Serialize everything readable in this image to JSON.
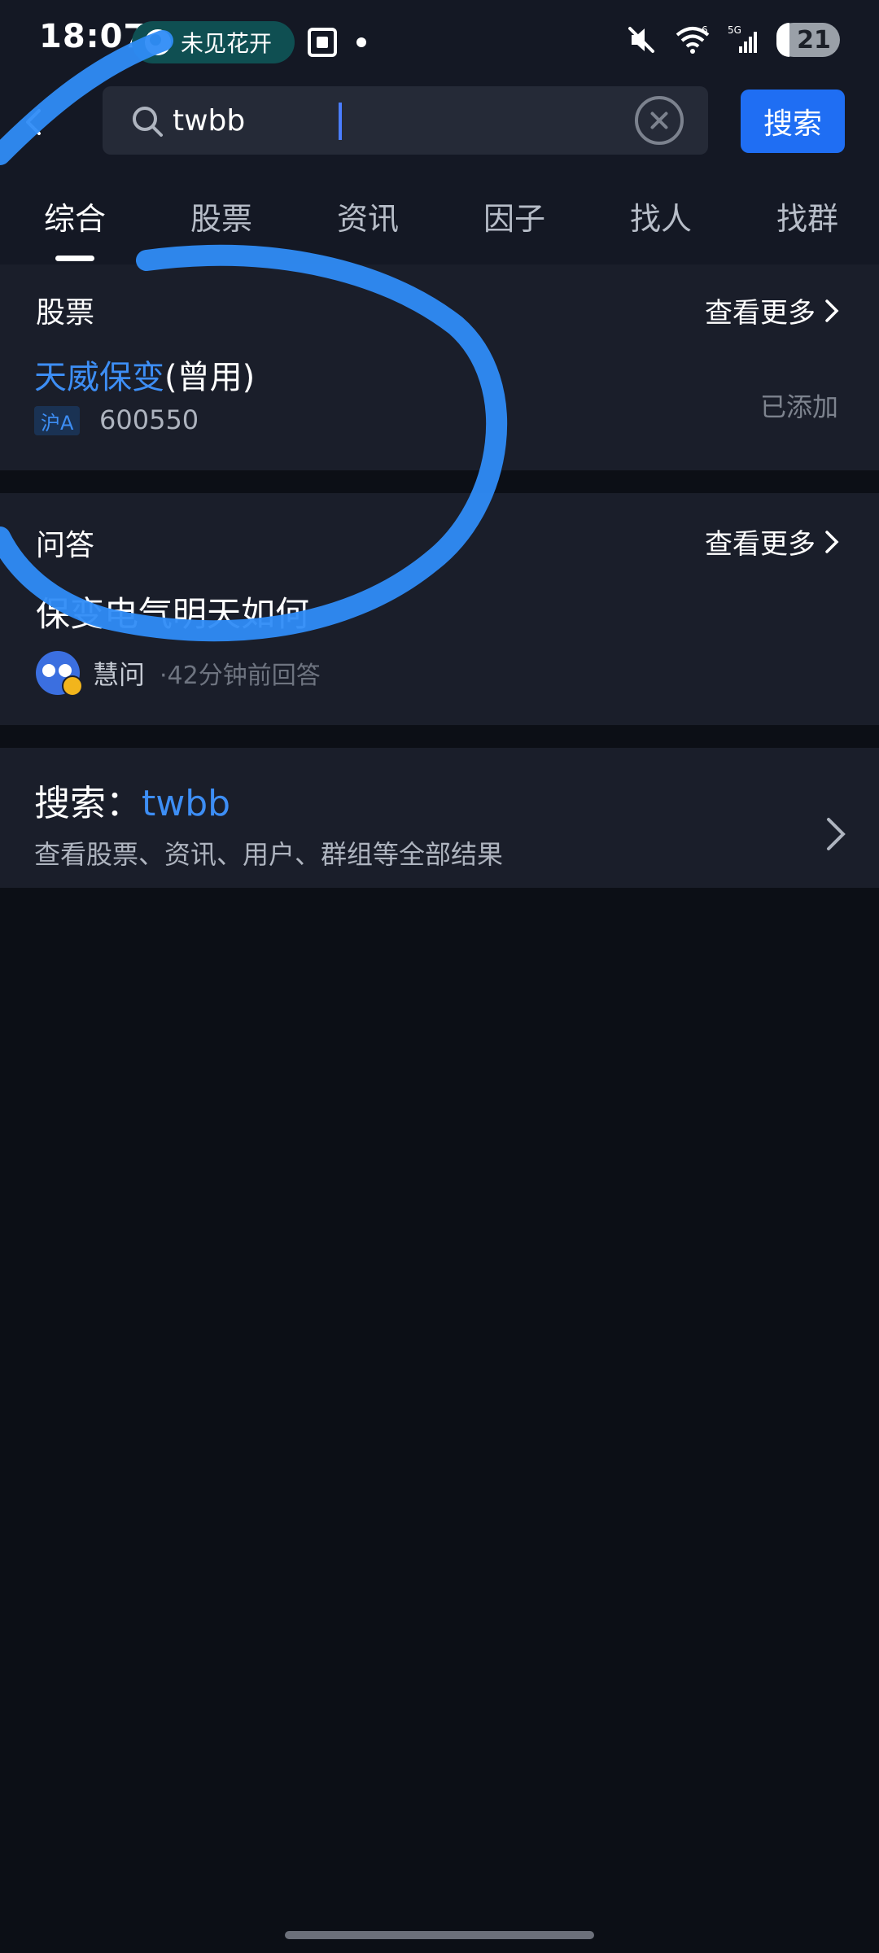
{
  "status_bar": {
    "time": "18:07",
    "flower_pill": "未见花开",
    "battery": "21",
    "battery_level": 0.21,
    "network": "5G",
    "wifi_badge": "6"
  },
  "search": {
    "value": "twbb",
    "button_label": "搜索"
  },
  "tabs": [
    {
      "label": "综合",
      "active": true
    },
    {
      "label": "股票",
      "active": false
    },
    {
      "label": "资讯",
      "active": false
    },
    {
      "label": "因子",
      "active": false
    },
    {
      "label": "找人",
      "active": false
    },
    {
      "label": "找群",
      "active": false
    }
  ],
  "stocks_section": {
    "title": "股票",
    "more_label": "查看更多",
    "item": {
      "name_highlight": "天威保变",
      "name_suffix": "(曾用)",
      "market": "沪A",
      "code": "600550",
      "status": "已添加"
    }
  },
  "qa_section": {
    "title": "问答",
    "more_label": "查看更多",
    "item": {
      "question": "保变电气明天如何",
      "author": "慧问",
      "time": "·42分钟前回答"
    }
  },
  "search_all": {
    "prefix": "搜索：",
    "keyword": "twbb",
    "subtitle": "查看股票、资讯、用户、群组等全部结果"
  },
  "colors": {
    "accent": "#1f6ef3",
    "highlight": "#3d8ef5",
    "background": "#0c0f16",
    "card": "#1a1e2a",
    "annotation_stroke": "#2f8cf7"
  }
}
